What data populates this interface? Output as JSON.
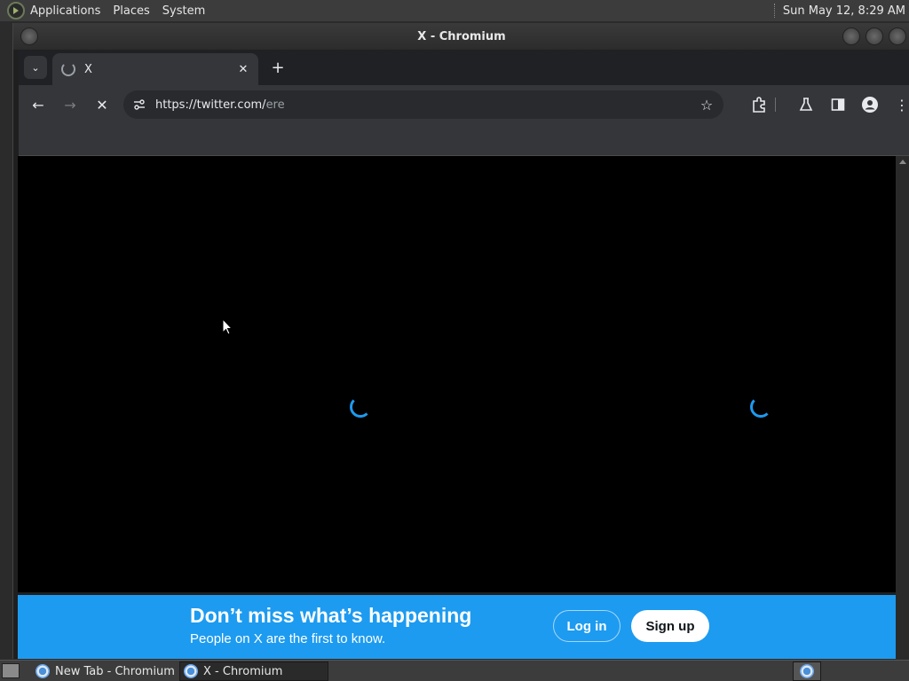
{
  "top_panel": {
    "menus": [
      "Applications",
      "Places",
      "System"
    ],
    "clock": "Sun May 12,  8:29 AM"
  },
  "window": {
    "title": "X - Chromium"
  },
  "browser": {
    "tab": {
      "title": "X",
      "close_glyph": "✕"
    },
    "new_tab_glyph": "+",
    "tab_search_glyph": "⌄",
    "toolbar": {
      "back_glyph": "←",
      "forward_glyph": "→",
      "stop_glyph": "✕",
      "star_glyph": "☆",
      "menu_glyph": "⋮"
    },
    "omnibox": {
      "url_host": "https://twitter.com/",
      "url_path": "ere"
    },
    "icons": [
      "site-info-icon",
      "extensions-icon",
      "labs-flask-icon",
      "side-panel-icon",
      "profile-icon",
      "menu-icon"
    ]
  },
  "page": {
    "loading": true,
    "banner": {
      "headline": "Don’t miss what’s happening",
      "subline": "People on X are the first to know.",
      "login_label": "Log in",
      "signup_label": "Sign up",
      "color": "#1d9bf0"
    }
  },
  "taskbar": {
    "tasks": [
      {
        "label": "New Tab - Chromium",
        "active": false
      },
      {
        "label": "X - Chromium",
        "active": true
      }
    ]
  }
}
